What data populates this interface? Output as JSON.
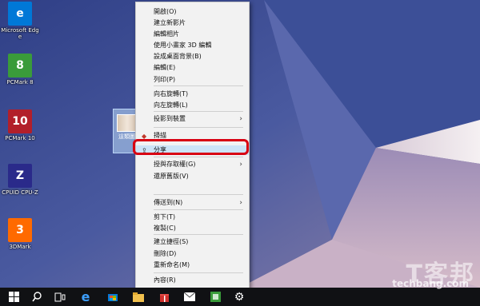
{
  "desktop": {
    "icons": [
      {
        "label": "Microsoft Edge",
        "glyph": "e",
        "color": "#0078d7"
      },
      {
        "label": "PCMark 8",
        "glyph": "8",
        "color": "#3a9b3a"
      },
      {
        "label": "PCMark 10",
        "glyph": "10",
        "color": "#b21f2a"
      },
      {
        "label": "CPUID CPU-Z",
        "glyph": "Z",
        "color": "#2a2a8a"
      },
      {
        "label": "3DMark",
        "glyph": "3",
        "color": "#ff6a00"
      }
    ],
    "selected_file_label": "這類圖片"
  },
  "context_menu": {
    "items": [
      {
        "label": "開啟(O)"
      },
      {
        "label": "建立新影片"
      },
      {
        "label": "編輯相片"
      },
      {
        "label": "使用小畫家 3D 編輯"
      },
      {
        "label": "設成桌面背景(B)"
      },
      {
        "label": "編輯(E)"
      },
      {
        "label": "列印(P)"
      },
      {
        "label": "向右旋轉(T)"
      },
      {
        "label": "向左旋轉(L)"
      },
      {
        "label": "投影到裝置",
        "submenu": true
      },
      {
        "label": "掃描",
        "icon": "defender-icon"
      },
      {
        "label": "分享",
        "icon": "share-icon"
      },
      {
        "label": "授與存取權(G)",
        "submenu": true
      },
      {
        "label": "還原舊版(V)"
      },
      {
        "label": "傳送到(N)",
        "submenu": true
      },
      {
        "label": "剪下(T)"
      },
      {
        "label": "複製(C)"
      },
      {
        "label": "建立捷徑(S)"
      },
      {
        "label": "刪除(D)"
      },
      {
        "label": "重新命名(M)"
      },
      {
        "label": "內容(R)"
      }
    ]
  },
  "taskbar": {
    "icons": [
      "start-icon",
      "search-icon",
      "task-view-icon",
      "edge-icon",
      "store-icon",
      "explorer-icon",
      "gift-icon",
      "mail-icon",
      "app-icon",
      "settings-icon"
    ]
  },
  "watermark": {
    "text": "T客邦",
    "sub": "techbang.com"
  },
  "colors": {
    "highlight": "#d80012",
    "menu_bg": "#f2f2f2",
    "taskbar": "#101114"
  }
}
